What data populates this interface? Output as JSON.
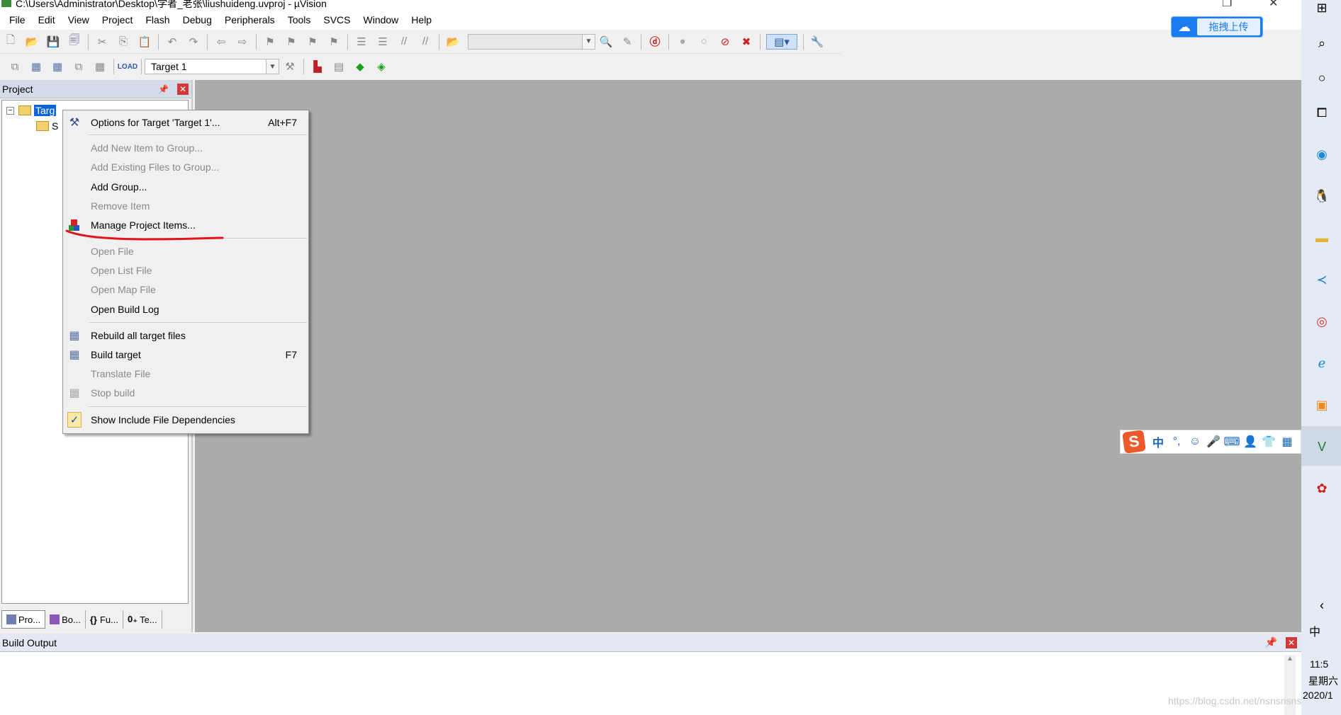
{
  "window": {
    "title": "C:\\Users\\Administrator\\Desktop\\学者_老张\\liushuideng.uvproj - µVision",
    "controls": [
      "restore",
      "close"
    ]
  },
  "menu": [
    "File",
    "Edit",
    "View",
    "Project",
    "Flash",
    "Debug",
    "Peripherals",
    "Tools",
    "SVCS",
    "Window",
    "Help"
  ],
  "toolbar2": {
    "target_combo": "Target 1"
  },
  "project_pane": {
    "title": "Project",
    "tree_root": "Target 1",
    "tree_child": "Source Group 1",
    "tree_root_visible": "Targ",
    "tree_child_visible": "S",
    "tabs": [
      "Pro...",
      "Bo...",
      "Fu...",
      "Te..."
    ]
  },
  "context_menu": {
    "items": [
      {
        "label": "Options for Target 'Target 1'...",
        "shortcut": "Alt+F7",
        "enabled": true,
        "icon": "magic-wand-icon"
      },
      {
        "label": "Add New Item to Group...",
        "enabled": false
      },
      {
        "label": "Add Existing Files to Group...",
        "enabled": false
      },
      {
        "label": "Add Group...",
        "enabled": true
      },
      {
        "label": "Remove Item",
        "enabled": false
      },
      {
        "label": "Manage Project Items...",
        "enabled": true,
        "icon": "project-items-icon",
        "underlined": true
      },
      {
        "label": "Open File",
        "enabled": false
      },
      {
        "label": "Open List File",
        "enabled": false
      },
      {
        "label": "Open Map File",
        "enabled": false
      },
      {
        "label": "Open Build Log",
        "enabled": true
      },
      {
        "label": "Rebuild all target files",
        "enabled": true,
        "icon": "rebuild-icon"
      },
      {
        "label": "Build target",
        "shortcut": "F7",
        "enabled": true,
        "icon": "build-icon"
      },
      {
        "label": "Translate File",
        "enabled": false
      },
      {
        "label": "Stop build",
        "enabled": false,
        "icon": "stop-build-icon"
      },
      {
        "label": "Show Include File Dependencies",
        "enabled": true,
        "checked": true
      }
    ]
  },
  "build_output": {
    "title": "Build Output"
  },
  "upload_button": {
    "label": "拖拽上传"
  },
  "ime_bar": {
    "mode": "中",
    "punct": "°,"
  },
  "taskbar": {
    "time": "11:5",
    "weekday": "星期六",
    "date": "2020/1",
    "ime_indicator": "中",
    "icons": [
      "windows-icon",
      "search-icon",
      "cortana-icon",
      "task-view-icon",
      "edge-icon",
      "qq-icon",
      "file-explorer-icon",
      "vscode-icon",
      "chrome-icon",
      "ie-icon",
      "app-icon",
      "keil-icon",
      "app2-icon"
    ]
  },
  "watermark": "https://blog.csdn.net/nsnsnsnsr",
  "colors": {
    "accent": "#0a64d8",
    "annotation": "#e0161b",
    "workspace": "#ababab"
  }
}
